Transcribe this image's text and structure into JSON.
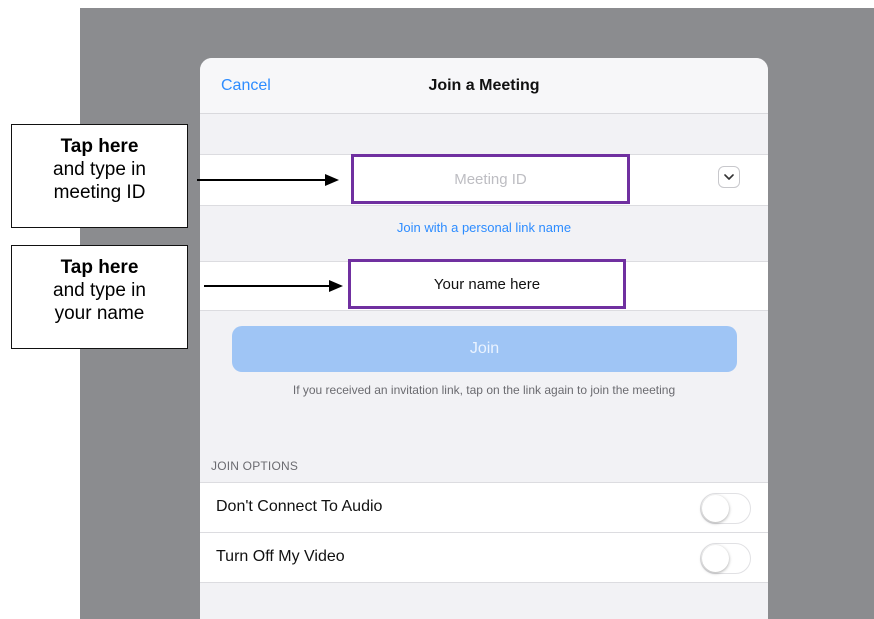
{
  "sheet": {
    "cancel_label": "Cancel",
    "title": "Join a Meeting",
    "meeting_id_placeholder": "Meeting ID",
    "personal_link_label": "Join with a personal link name",
    "name_value": "Your name here",
    "join_label": "Join",
    "hint": "If you received an invitation link, tap on the link again to join the meeting",
    "section_label": "JOIN OPTIONS",
    "options": [
      {
        "label": "Don't Connect To Audio",
        "enabled": false
      },
      {
        "label": "Turn Off My Video",
        "enabled": false
      }
    ]
  },
  "callouts": [
    {
      "bold": "Tap here",
      "line2": "and type in",
      "line3": "meeting ID"
    },
    {
      "bold": "Tap here",
      "line2": "and type in",
      "line3": "your name"
    }
  ],
  "colors": {
    "accent": "#2d8cff",
    "highlight_border": "#7030a0",
    "join_button": "#9fc5f5",
    "backdrop": "#8b8c8f"
  },
  "icons": {
    "dropdown": "chevron-down-icon",
    "arrow": "arrow-right-icon"
  }
}
